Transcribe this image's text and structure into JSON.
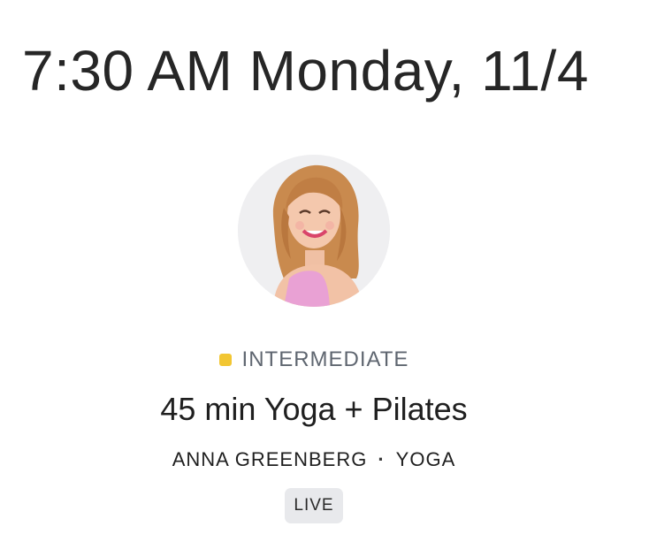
{
  "schedule": {
    "datetime": "7:30 AM Monday, 11/4"
  },
  "class_card": {
    "avatar_icon": "instructor-avatar",
    "level": {
      "label": "INTERMEDIATE",
      "color": "#f2c632"
    },
    "title": "45 min Yoga + Pilates",
    "instructor": "ANNA GREENBERG",
    "separator": "·",
    "category": "YOGA",
    "badge": "LIVE"
  }
}
